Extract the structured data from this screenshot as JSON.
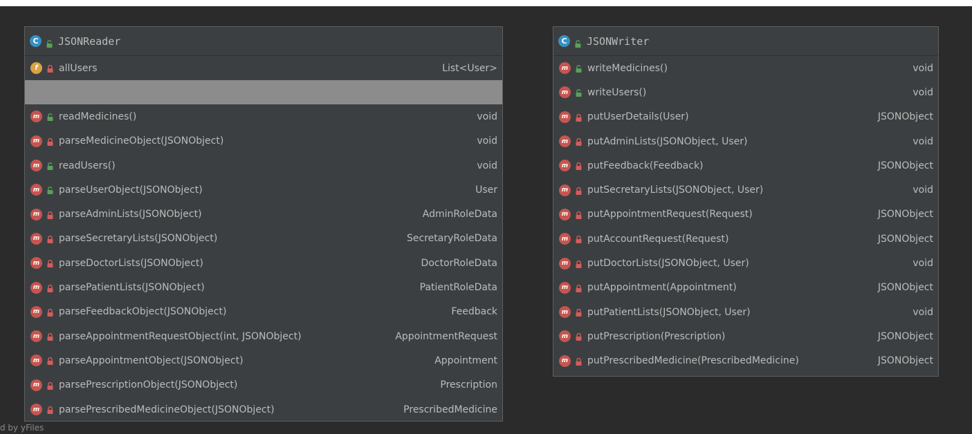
{
  "reader": {
    "title": "JSONReader",
    "class_icon": "class-icon",
    "field": {
      "name": "allUsers",
      "type": "List<User>",
      "icon": "field-icon",
      "visibility": "private"
    },
    "methods": [
      {
        "name": "readMedicines()",
        "type": "void",
        "visibility": "public"
      },
      {
        "name": "parseMedicineObject(JSONObject)",
        "type": "void",
        "visibility": "private"
      },
      {
        "name": "readUsers()",
        "type": "void",
        "visibility": "public"
      },
      {
        "name": "parseUserObject(JSONObject)",
        "type": "User",
        "visibility": "public"
      },
      {
        "name": "parseAdminLists(JSONObject)",
        "type": "AdminRoleData",
        "visibility": "private"
      },
      {
        "name": "parseSecretaryLists(JSONObject)",
        "type": "SecretaryRoleData",
        "visibility": "private"
      },
      {
        "name": "parseDoctorLists(JSONObject)",
        "type": "DoctorRoleData",
        "visibility": "private"
      },
      {
        "name": "parsePatientLists(JSONObject)",
        "type": "PatientRoleData",
        "visibility": "private"
      },
      {
        "name": "parseFeedbackObject(JSONObject)",
        "type": "Feedback",
        "visibility": "private"
      },
      {
        "name": "parseAppointmentRequestObject(int, JSONObject)",
        "type": "AppointmentRequest",
        "visibility": "private"
      },
      {
        "name": "parseAppointmentObject(JSONObject)",
        "type": "Appointment",
        "visibility": "private"
      },
      {
        "name": "parsePrescriptionObject(JSONObject)",
        "type": "Prescription",
        "visibility": "private"
      },
      {
        "name": "parsePrescribedMedicineObject(JSONObject)",
        "type": "PrescribedMedicine",
        "visibility": "private"
      }
    ]
  },
  "writer": {
    "title": "JSONWriter",
    "class_icon": "class-icon",
    "methods": [
      {
        "name": "writeMedicines()",
        "type": "void",
        "visibility": "public"
      },
      {
        "name": "writeUsers()",
        "type": "void",
        "visibility": "public"
      },
      {
        "name": "putUserDetails(User)",
        "type": "JSONObject",
        "visibility": "private"
      },
      {
        "name": "putAdminLists(JSONObject, User)",
        "type": "void",
        "visibility": "private"
      },
      {
        "name": "putFeedback(Feedback)",
        "type": "JSONObject",
        "visibility": "private"
      },
      {
        "name": "putSecretaryLists(JSONObject, User)",
        "type": "void",
        "visibility": "private"
      },
      {
        "name": "putAppointmentRequest(Request)",
        "type": "JSONObject",
        "visibility": "private"
      },
      {
        "name": "putAccountRequest(Request)",
        "type": "JSONObject",
        "visibility": "private"
      },
      {
        "name": "putDoctorLists(JSONObject, User)",
        "type": "void",
        "visibility": "private"
      },
      {
        "name": "putAppointment(Appointment)",
        "type": "JSONObject",
        "visibility": "private"
      },
      {
        "name": "putPatientLists(JSONObject, User)",
        "type": "void",
        "visibility": "private"
      },
      {
        "name": "putPrescription(Prescription)",
        "type": "JSONObject",
        "visibility": "private"
      },
      {
        "name": "putPrescribedMedicine(PrescribedMedicine)",
        "type": "JSONObject",
        "visibility": "private"
      }
    ]
  },
  "icons": {
    "class": "C",
    "method": "m",
    "field": "f"
  },
  "colors": {
    "background": "#2b2b2b",
    "box": "#3c3f41",
    "text": "#bbbbbb",
    "class_icon": "#3592c4",
    "method_icon": "#c7554f",
    "field_icon": "#d9a343",
    "public": "#5aa05a",
    "private": "#d45c5c",
    "separator": "#8c8c8c"
  },
  "footer": "d by yFiles"
}
